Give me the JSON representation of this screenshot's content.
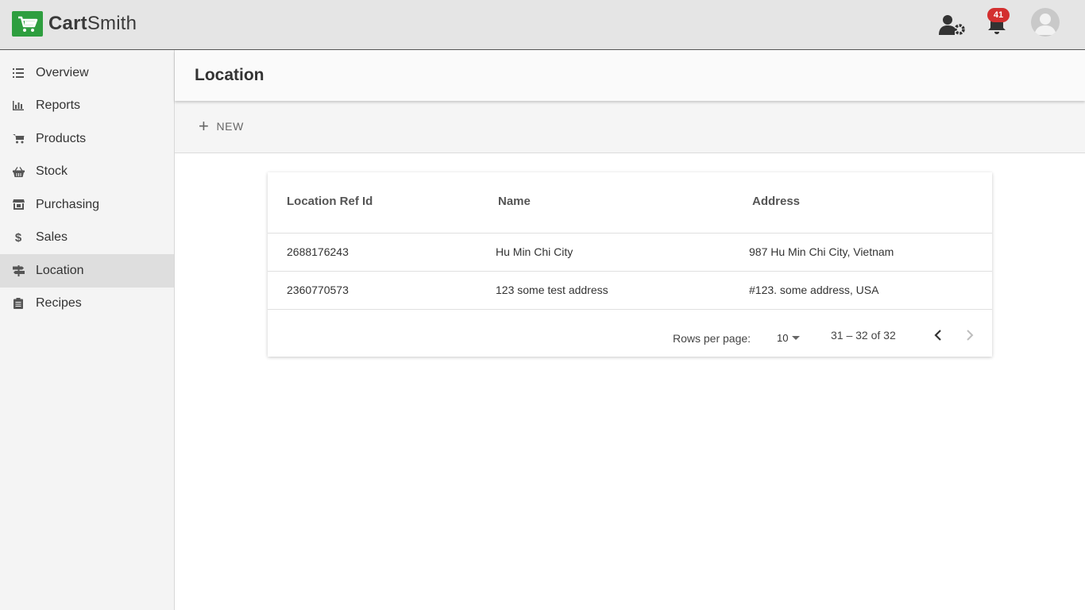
{
  "app": {
    "logo_part1": "Cart",
    "logo_part2": "Smith",
    "notification_count": "41"
  },
  "icons": {
    "logo": "cart-icon",
    "user_settings": "user-cog-icon",
    "notifications": "bell-icon",
    "avatar": "user-avatar-icon"
  },
  "sidebar": {
    "items": [
      {
        "label": "Overview",
        "icon": "list-icon"
      },
      {
        "label": "Reports",
        "icon": "bar-chart-icon"
      },
      {
        "label": "Products",
        "icon": "shopping-cart-icon"
      },
      {
        "label": "Stock",
        "icon": "basket-icon"
      },
      {
        "label": "Purchasing",
        "icon": "store-icon"
      },
      {
        "label": "Sales",
        "icon": "dollar-icon"
      },
      {
        "label": "Location",
        "icon": "signpost-icon",
        "active": true
      },
      {
        "label": "Recipes",
        "icon": "clipboard-icon"
      }
    ]
  },
  "page": {
    "title": "Location",
    "new_button": "NEW"
  },
  "table": {
    "columns": [
      "Location Ref Id",
      "Name",
      "Address"
    ],
    "rows": [
      [
        "2688176243",
        "Hu Min Chi City",
        "987 Hu Min Chi City, Vietnam"
      ],
      [
        "2360770573",
        "123 some test address",
        "#123. some address, USA"
      ]
    ],
    "footer": {
      "rows_per_page_label": "Rows per page:",
      "rows_per_page_value": "10",
      "range_text": "31 – 32 of 32"
    }
  },
  "colors": {
    "brand_green": "#2e9e3f",
    "badge_red": "#d32f2f",
    "active_nav_bg": "#dedede"
  }
}
